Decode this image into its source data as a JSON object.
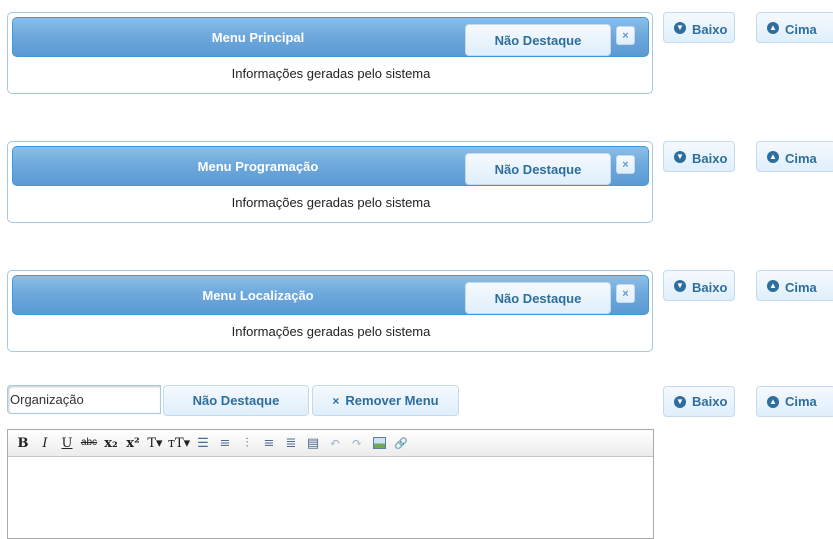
{
  "panels": [
    {
      "title": "Menu Principal",
      "highlight_label": "Não Destaque",
      "close_glyph": "×",
      "info": "Informações geradas pelo sistema"
    },
    {
      "title": "Menu Programação",
      "highlight_label": "Não Destaque",
      "close_glyph": "×",
      "info": "Informações geradas pelo sistema"
    },
    {
      "title": "Menu Localização",
      "highlight_label": "Não Destaque",
      "close_glyph": "×",
      "info": "Informações geradas pelo sistema"
    }
  ],
  "controls": {
    "down_label": "Baixo",
    "up_label": "Cima"
  },
  "new_menu": {
    "name_value": "Organização",
    "highlight_label": "Não Destaque",
    "remove_label": "Remover Menu"
  },
  "editor": {
    "toolbar": [
      {
        "name": "bold-icon",
        "glyph": "B"
      },
      {
        "name": "italic-icon",
        "glyph": "I"
      },
      {
        "name": "underline-icon",
        "glyph": "U"
      },
      {
        "name": "strikethrough-icon",
        "glyph": "abc"
      },
      {
        "name": "subscript-icon",
        "glyph": "x₂"
      },
      {
        "name": "superscript-icon",
        "glyph": "x²"
      },
      {
        "name": "font-size-icon",
        "glyph": "T▾"
      },
      {
        "name": "font-family-icon",
        "glyph": "тT▾"
      },
      {
        "name": "bullet-list-icon",
        "glyph": "☰"
      },
      {
        "name": "numbered-list-icon",
        "glyph": "≡"
      },
      {
        "name": "align-left-icon",
        "glyph": "⫶"
      },
      {
        "name": "align-center-icon",
        "glyph": "≡"
      },
      {
        "name": "align-right-icon",
        "glyph": "≣"
      },
      {
        "name": "justify-icon",
        "glyph": "▤"
      },
      {
        "name": "undo-icon",
        "glyph": "↶"
      },
      {
        "name": "redo-icon",
        "glyph": "↷"
      },
      {
        "name": "image-icon",
        "glyph": ""
      },
      {
        "name": "link-icon",
        "glyph": "🔗"
      }
    ]
  },
  "colors": {
    "header": "#6ea9dc",
    "button_text": "#2e6e9e",
    "border": "#a6c9e2"
  }
}
